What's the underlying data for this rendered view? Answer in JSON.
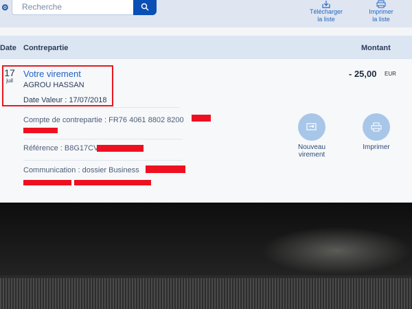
{
  "search": {
    "placeholder": "Recherche"
  },
  "toolbar": {
    "download_label_line1": "Télécharger",
    "download_label_line2": "la liste",
    "print_label_line1": "Imprimer",
    "print_label_line2": "la liste"
  },
  "table": {
    "headers": {
      "date": "Date",
      "contrepartie": "Contrepartie",
      "montant": "Montant"
    }
  },
  "transaction": {
    "day": "17",
    "month": "juil",
    "title": "Votre virement",
    "counterparty_name": "AGROU HASSAN",
    "value_date": "Date Valeur : 17/07/2018",
    "amount": "- 25,00",
    "currency": "EUR",
    "account": "Compte de contrepartie : FR76 4061 8802 8200",
    "reference": "Référence : B8G17CV",
    "communication": "Communication : dossier Business"
  },
  "actions": {
    "new_transfer_line1": "Nouveau",
    "new_transfer_line2": "virement",
    "print": "Imprimer"
  },
  "colors": {
    "accent_blue": "#1c62c4",
    "search_button": "#0a4fb5",
    "highlight_red": "#e8171f",
    "action_circle": "#a8c6e8"
  },
  "icons": {
    "search_button": "search-icon",
    "download": "download-icon",
    "print_list": "printer-icon",
    "new_transfer": "transfer-icon",
    "print": "printer-icon"
  }
}
